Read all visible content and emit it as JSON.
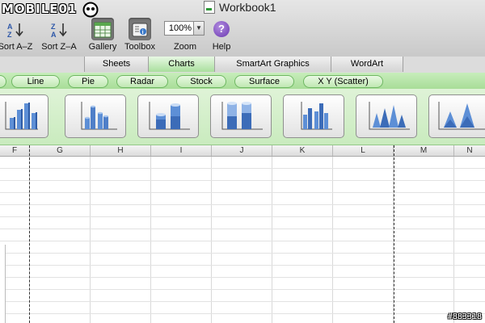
{
  "logo": {
    "text": "MOBILE01"
  },
  "window": {
    "title": "Workbook1",
    "file_badge": "XLSX"
  },
  "toolbar": {
    "sort_az": "Sort A–Z",
    "sort_za": "Sort Z–A",
    "gallery": "Gallery",
    "toolbox": "Toolbox",
    "zoom": "Zoom",
    "zoom_value": "100%",
    "help": "Help"
  },
  "ribbon_tabs": [
    "Sheets",
    "Charts",
    "SmartArt Graphics",
    "WordArt"
  ],
  "active_tab": "Charts",
  "chart_types": [
    "Line",
    "Pie",
    "Radar",
    "Stock",
    "Surface",
    "X Y (Scatter)"
  ],
  "gallery_items": [
    {
      "icon": "3d-column-chart-icon"
    },
    {
      "icon": "3d-cylinder-clustered-chart-icon"
    },
    {
      "icon": "3d-cylinder-stacked-chart-icon"
    },
    {
      "icon": "3d-cylinder-100-stacked-chart-icon"
    },
    {
      "icon": "3d-column-clustered-chart-icon"
    },
    {
      "icon": "3d-cone-chart-icon"
    },
    {
      "icon": "3d-cone-stacked-chart-icon"
    }
  ],
  "columns": [
    "F",
    "G",
    "H",
    "I",
    "J",
    "K",
    "L",
    "M",
    "N"
  ],
  "watermark": "#883318",
  "colors": {
    "accent_green": "#a9df9d",
    "chart_blue": "#4f7fc8"
  }
}
